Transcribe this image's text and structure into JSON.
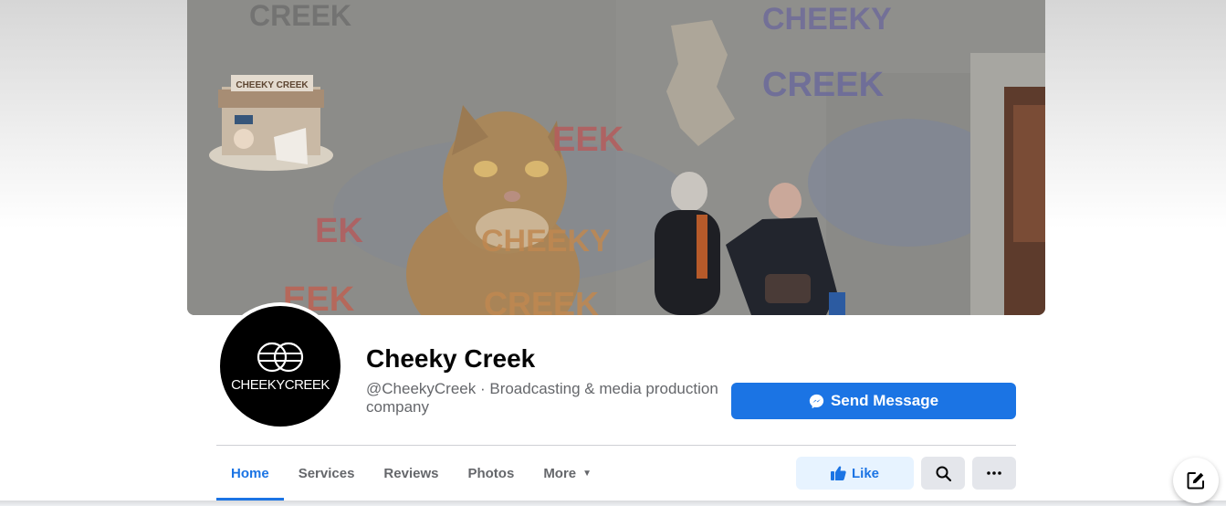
{
  "profile": {
    "name": "Cheeky Creek",
    "subtitle": "@CheekyCreek · Broadcasting & media production company",
    "avatar_text": "CHEEKYCREEK"
  },
  "cover": {
    "wall_texts": [
      "CREEK",
      "CHEEKY",
      "CREEK",
      "EEK",
      "EK",
      "CHEEKY",
      "EEK",
      "CREEK"
    ],
    "sign_text": "CHEEKY CREEK"
  },
  "actions": {
    "send_message": "Send Message",
    "like": "Like"
  },
  "tabs": [
    {
      "label": "Home",
      "active": true
    },
    {
      "label": "Services"
    },
    {
      "label": "Reviews"
    },
    {
      "label": "Photos"
    },
    {
      "label": "More"
    }
  ],
  "icons": {
    "messenger": "messenger-icon",
    "like": "thumbs-up-icon",
    "search": "search-icon",
    "more": "more-horizontal-icon",
    "compose": "compose-icon",
    "more_tab": "caret-down-icon"
  },
  "colors": {
    "accent": "#1b74e4",
    "accent_light": "#e7f3ff",
    "secondary_button": "#e4e6eb",
    "text_primary": "#050505",
    "text_secondary": "#65676b"
  }
}
